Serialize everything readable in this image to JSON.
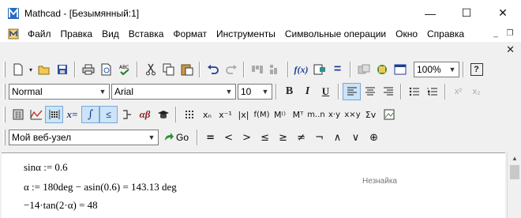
{
  "window": {
    "title": "Mathcad - [Безымянный:1]",
    "controls": {
      "minimize": "—",
      "maximize": "☐",
      "close": "✕"
    }
  },
  "menu": {
    "items": [
      "Файл",
      "Правка",
      "Вид",
      "Вставка",
      "Формат",
      "Инструменты",
      "Символьные операции",
      "Окно",
      "Справка"
    ],
    "mdi": {
      "minimize": "_",
      "restore": "❐",
      "close": "✕"
    }
  },
  "standard_toolbar": {
    "zoom": "100%",
    "help_label": "?"
  },
  "formatting_toolbar": {
    "style": "Normal",
    "font": "Arial",
    "size": "10",
    "bold": "B",
    "italic": "I",
    "underline": "U"
  },
  "math_toolbar": {
    "equals_label": "x=",
    "greek_label": "αβ"
  },
  "web_toolbar": {
    "address": "Мой веб-узел",
    "go_label": "Go",
    "operators": [
      "=",
      "<",
      ">",
      "≤",
      "≥",
      "≠",
      "¬",
      "∧",
      "∨",
      "⊕"
    ]
  },
  "worksheet": {
    "lines": [
      "sinα := 0.6",
      "α := 180deg − asin(0.6) = 143.13 deg",
      "−14·tan(2·α) = 48"
    ],
    "note": "Незнайка"
  },
  "colors": {
    "titlebar": "#ffffff",
    "toolbar": "#f0f0f0",
    "pressed": "#cce4f7",
    "accent_blue": "#1f5fbf"
  }
}
